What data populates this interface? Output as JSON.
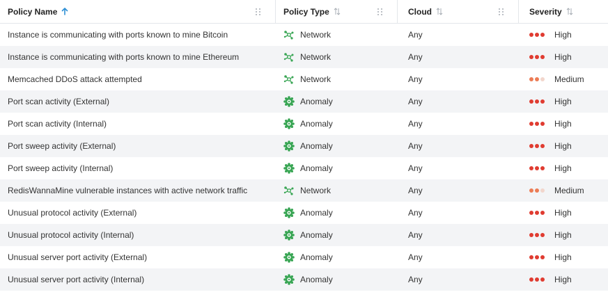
{
  "columns": {
    "policy_name": "Policy Name",
    "policy_type": "Policy Type",
    "cloud": "Cloud",
    "severity": "Severity"
  },
  "colors": {
    "accent_sort": "#2d8fd5",
    "icon_green": "#3aa655",
    "severity_high": "#e03c31",
    "severity_medium": "#ec7c55",
    "row_alt": "#f3f4f6"
  },
  "rows": [
    {
      "name": "Instance is communicating with ports known to mine Bitcoin",
      "type": "Network",
      "type_icon": "network-icon",
      "cloud": "Any",
      "severity": "High"
    },
    {
      "name": "Instance is communicating with ports known to mine Ethereum",
      "type": "Network",
      "type_icon": "network-icon",
      "cloud": "Any",
      "severity": "High"
    },
    {
      "name": "Memcached DDoS attack attempted",
      "type": "Network",
      "type_icon": "network-icon",
      "cloud": "Any",
      "severity": "Medium"
    },
    {
      "name": "Port scan activity (External)",
      "type": "Anomaly",
      "type_icon": "anomaly-gear-icon",
      "cloud": "Any",
      "severity": "High"
    },
    {
      "name": "Port scan activity (Internal)",
      "type": "Anomaly",
      "type_icon": "anomaly-gear-icon",
      "cloud": "Any",
      "severity": "High"
    },
    {
      "name": "Port sweep activity (External)",
      "type": "Anomaly",
      "type_icon": "anomaly-gear-icon",
      "cloud": "Any",
      "severity": "High"
    },
    {
      "name": "Port sweep activity (Internal)",
      "type": "Anomaly",
      "type_icon": "anomaly-gear-icon",
      "cloud": "Any",
      "severity": "High"
    },
    {
      "name": "RedisWannaMine vulnerable instances with active network traffic",
      "type": "Network",
      "type_icon": "network-icon",
      "cloud": "Any",
      "severity": "Medium"
    },
    {
      "name": "Unusual protocol activity (External)",
      "type": "Anomaly",
      "type_icon": "anomaly-gear-icon",
      "cloud": "Any",
      "severity": "High"
    },
    {
      "name": "Unusual protocol activity (Internal)",
      "type": "Anomaly",
      "type_icon": "anomaly-gear-icon",
      "cloud": "Any",
      "severity": "High"
    },
    {
      "name": "Unusual server port activity (External)",
      "type": "Anomaly",
      "type_icon": "anomaly-gear-icon",
      "cloud": "Any",
      "severity": "High"
    },
    {
      "name": "Unusual server port activity (Internal)",
      "type": "Anomaly",
      "type_icon": "anomaly-gear-icon",
      "cloud": "Any",
      "severity": "High"
    }
  ]
}
